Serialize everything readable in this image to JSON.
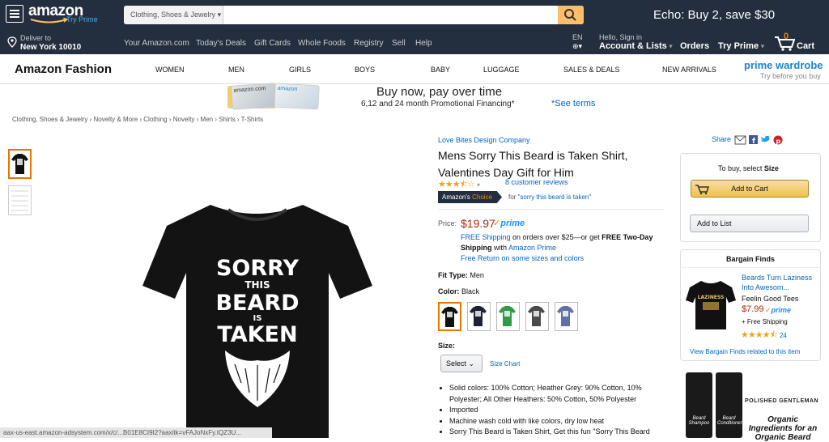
{
  "nav": {
    "logo": "amazon",
    "try_prime": "Try Prime",
    "search_category": "Clothing, Shoes & Jewelry",
    "search_value": "",
    "promo": "Echo: Buy 2, save $30",
    "deliver_line1": "Deliver to",
    "deliver_line2": "New York 10010",
    "links": [
      "Your Amazon.com",
      "Today's Deals",
      "Gift Cards",
      "Whole Foods",
      "Registry",
      "Sell",
      "Help"
    ],
    "lang": "EN",
    "signin_line1": "Hello, Sign in",
    "signin_line2": "Account & Lists",
    "orders": "Orders",
    "try_prime_menu": "Try Prime",
    "cart_count": "0",
    "cart_label": "Cart"
  },
  "subnav": {
    "brand": "Amazon Fashion",
    "categories": [
      "WOMEN",
      "MEN",
      "GIRLS",
      "BOYS",
      "BABY",
      "LUGGAGE",
      "SALES & DEALS",
      "NEW ARRIVALS"
    ],
    "prime_wardrobe": "prime wardrobe",
    "prime_wardrobe_tag": "Try before you buy"
  },
  "banner": {
    "title": "Buy now, pay over time",
    "subtitle": "6,12 and 24 month Promotional Financing*",
    "link": "*See terms"
  },
  "breadcrumb": "Clothing, Shoes & Jewelry › Novelty & More › Clothing › Novelty › Men › Shirts › T-Shirts",
  "product": {
    "brand": "Love Bites Design Company",
    "title": "Mens Sorry This Beard is Taken Shirt, Valentines Day Gift for Him",
    "reviews": "8 customer reviews",
    "rating": 3.5,
    "choice_badge_1": "Amazon's",
    "choice_badge_2": "Choice",
    "choice_for": "for",
    "choice_query": "\"sorry this beard is taken\"",
    "price_label": "Price:",
    "price": "$19.97",
    "prime": "prime",
    "shipping_1a": "FREE Shipping",
    "shipping_1b": " on orders over $25—or get ",
    "shipping_1c": "FREE Two-Day",
    "shipping_2a": "Shipping",
    "shipping_2b": " with ",
    "shipping_2c": "Amazon Prime",
    "free_return": "Free Return on some sizes and colors",
    "fit_label": "Fit Type:",
    "fit_value": "Men",
    "color_label": "Color:",
    "color_value": "Black",
    "swatch_colors": [
      "#111111",
      "#1b2236",
      "#2f9a48",
      "#4a4a4a",
      "#6270a8"
    ],
    "size_label": "Size:",
    "size_select": "Select",
    "size_chart": "Size Chart",
    "bullets": [
      "Solid colors: 100% Cotton; Heather Grey: 90% Cotton, 10% Polyester; All Other Heathers: 50% Cotton, 50% Polyester",
      "Imported",
      "Machine wash cold with like colors, dry low heat",
      "Sorry This Beard is Taken Shirt, Get this fun \"Sorry This Beard"
    ],
    "shirt_text": [
      "SORRY",
      "THIS",
      "BEARD",
      "IS",
      "TAKEN"
    ]
  },
  "share": {
    "label": "Share"
  },
  "buybox": {
    "to_buy_prefix": "To buy, select ",
    "to_buy_bold": "Size",
    "add_to_cart": "Add to Cart",
    "add_to_list": "Add to List"
  },
  "bargain": {
    "heading": "Bargain Finds",
    "item_title": "Beards Turn Laziness Into Awesom...",
    "item_seller": "Feelin Good Tees",
    "item_price": "$7.99",
    "item_prime": "prime",
    "item_shipping": "+ Free Shipping",
    "item_reviews": "24",
    "item_rating": 4.5,
    "view_link": "View Bargain Finds related to this item",
    "shirt_text": "LAZINESS"
  },
  "ad": {
    "brand": "POLISHED GENTLEMAN",
    "tagline": "Organic Ingredients for an Organic Beard",
    "bottle_1": "Beard Shampoo",
    "bottle_2": "Beard Conditioner"
  },
  "status_url": "aax-us-east.amazon-adsystem.com/x/c/...B01E8CI9I2?aaxitk=vFAJoNxFy.IQZ3U...",
  "colors": {
    "nav_bg": "#232f3e",
    "accent": "#febd69",
    "link": "#0066c0",
    "price": "#b12704",
    "prime": "#1e90ff"
  }
}
